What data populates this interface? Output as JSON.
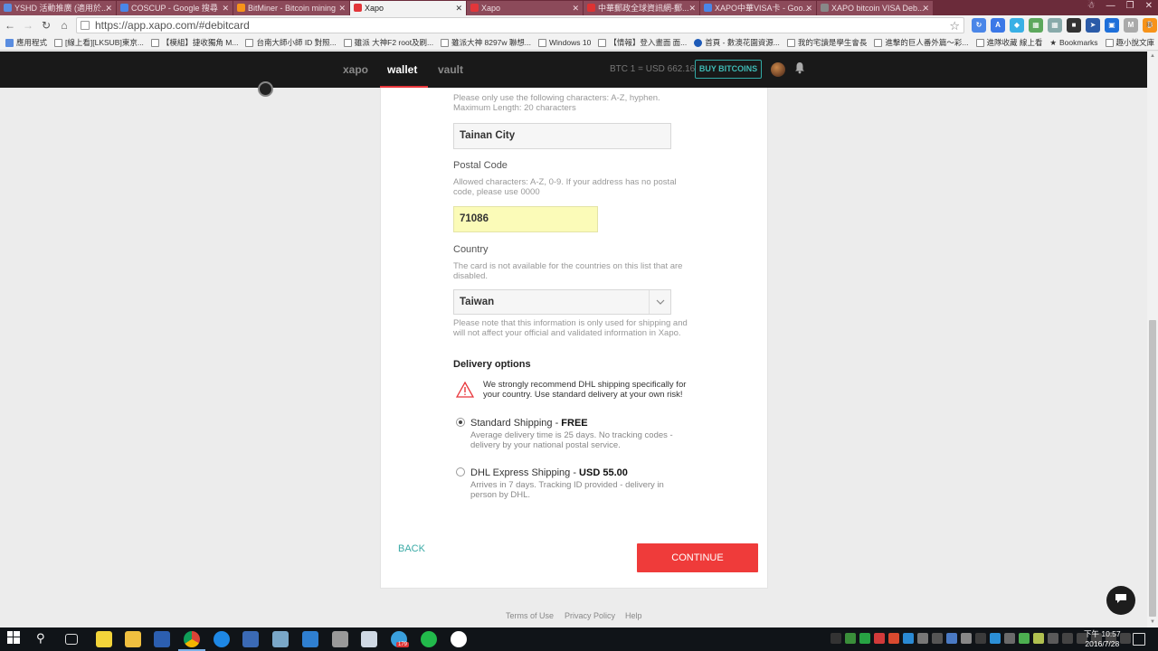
{
  "browser": {
    "tabs": [
      {
        "title": "YSHD 活動推廣 (適用於...",
        "color": "#5a8de0"
      },
      {
        "title": "COSCUP - Google 搜尋",
        "color": "#4a86e8"
      },
      {
        "title": "BitMiner - Bitcoin mining",
        "color": "#f7931a"
      },
      {
        "title": "Xapo",
        "color": "#e2363a",
        "active": true
      },
      {
        "title": "Xapo",
        "color": "#e2363a"
      },
      {
        "title": "中華郵政全球資訊網-郵...",
        "color": "#d33"
      },
      {
        "title": "XAPO中華VISA卡 - Goo...",
        "color": "#4a86e8"
      },
      {
        "title": "XAPO bitcoin VISA Deb...",
        "color": "#888"
      }
    ],
    "url": "https://app.xapo.com/#debitcard",
    "bookmarks": [
      "應用程式",
      "[線上看][LKSUB]東京...",
      "【模組】捷收獨角 M...",
      "台南大師小師 ID 對照...",
      "雖派 大神F2 root及刷...",
      "雖派大神 8297w 聯想...",
      "Windows 10",
      "【情報】登入畫面 面...",
      "首頁 - 數澳花園資源...",
      "我的宅讀是學生會長",
      "進擊的巨人番外篇～彩...",
      "進隊收藏 線上看",
      "Bookmarks",
      "趣小說文庫"
    ]
  },
  "header": {
    "nav": [
      "xapo",
      "wallet",
      "vault"
    ],
    "active_nav": "wallet",
    "btc_price": "BTC 1 = USD 662.16",
    "buy_label": "BUY BITCOINS"
  },
  "form": {
    "city_help": "Please only use the following characters: A-Z, hyphen. Maximum Length: 20 characters",
    "city_value": "Tainan City",
    "postal_label": "Postal Code",
    "postal_help": "Allowed characters: A-Z, 0-9. If your address has no postal code, please use 0000",
    "postal_value": "71086",
    "country_label": "Country",
    "country_help": "The card is not available for the countries on this list that are disabled.",
    "country_value": "Taiwan",
    "country_note": "Please note that this information is only used for shipping and will not affect your official and validated information in Xapo."
  },
  "delivery": {
    "title": "Delivery options",
    "warning": "We strongly recommend DHL shipping specifically for your country. Use standard delivery at your own risk!",
    "options": [
      {
        "name": "Standard Shipping - ",
        "price": "FREE",
        "desc": "Average delivery time is 25 days. No tracking codes - delivery by your national postal service.",
        "checked": true
      },
      {
        "name": "DHL Express Shipping - ",
        "price": "USD 55.00",
        "desc": "Arrives in 7 days. Tracking ID provided - delivery in person by DHL.",
        "checked": false
      }
    ]
  },
  "actions": {
    "back": "BACK",
    "continue": "CONTINUE"
  },
  "footer": {
    "links": [
      "Terms of Use",
      "Privacy Policy",
      "Help"
    ]
  },
  "taskbar": {
    "clock_time": "下午 10:57",
    "clock_date": "2016/7/28",
    "badge": "179"
  },
  "colors": {
    "accent_red": "#ef3b3a",
    "accent_teal": "#3aaaa6",
    "header_bg": "#191919"
  }
}
